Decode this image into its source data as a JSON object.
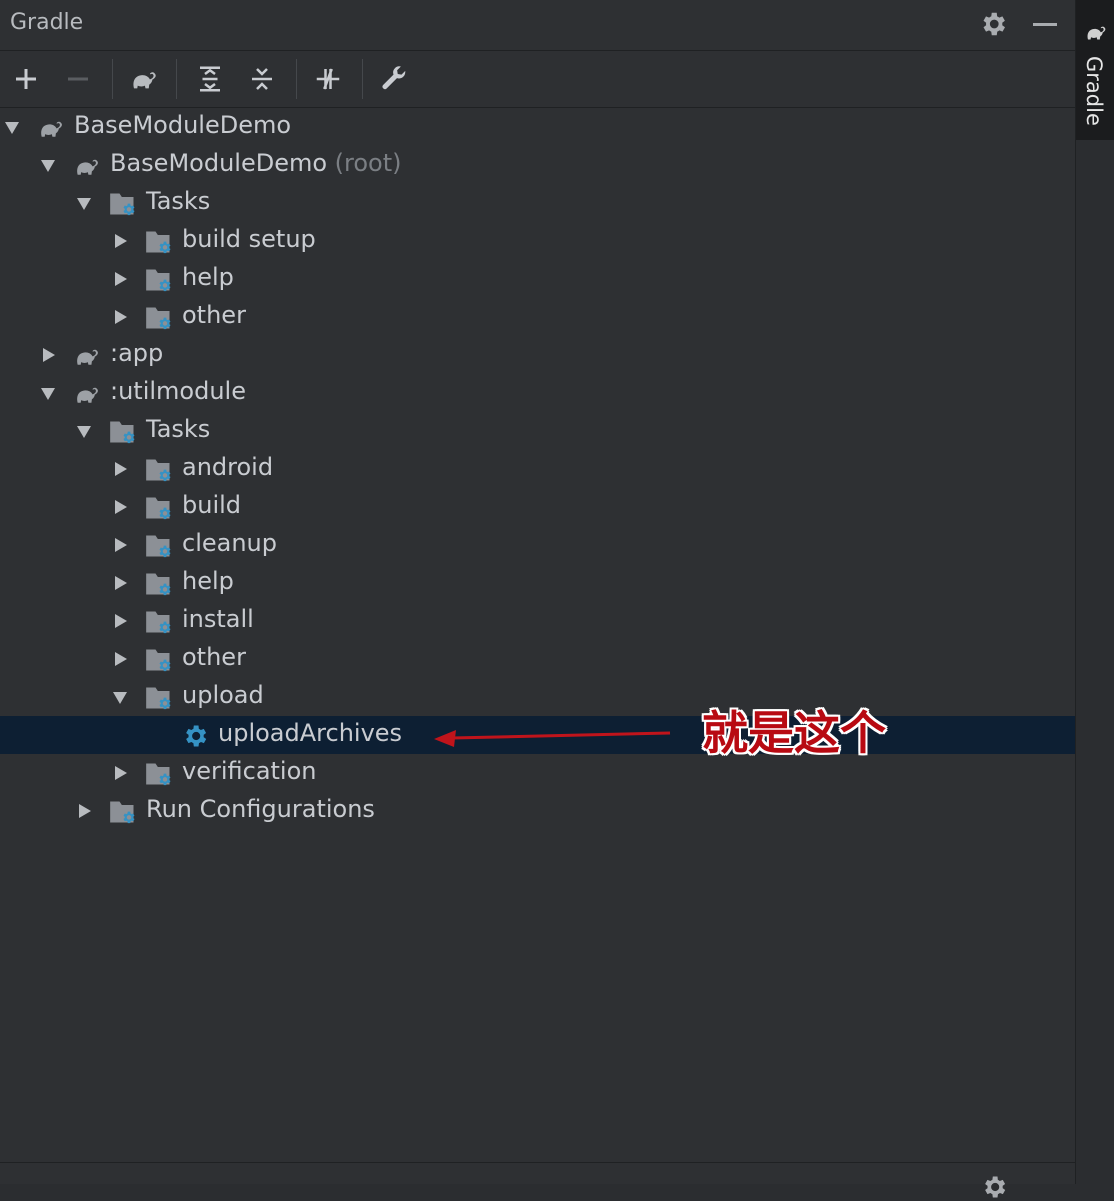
{
  "panel": {
    "title": "Gradle",
    "settings_icon": "gear-icon",
    "minimize_icon": "minimize-icon"
  },
  "toolbar": [
    {
      "icon": "add-icon"
    },
    {
      "icon": "remove-icon"
    },
    {
      "icon": "elephant-icon"
    },
    {
      "icon": "expand-all-icon"
    },
    {
      "icon": "collapse-all-icon"
    },
    {
      "icon": "toggle-offline-icon"
    },
    {
      "icon": "wrench-icon"
    }
  ],
  "tree": [
    {
      "label": "BaseModuleDemo",
      "suffix": "",
      "level": 0,
      "icon": "elephant",
      "expanded": true,
      "selected": false
    },
    {
      "label": "BaseModuleDemo",
      "suffix": "(root)",
      "level": 1,
      "icon": "elephant",
      "expanded": true,
      "selected": false
    },
    {
      "label": "Tasks",
      "suffix": "",
      "level": 2,
      "icon": "folder",
      "expanded": true,
      "selected": false
    },
    {
      "label": "build setup",
      "suffix": "",
      "level": 3,
      "icon": "folder",
      "expanded": false,
      "selected": false
    },
    {
      "label": "help",
      "suffix": "",
      "level": 3,
      "icon": "folder",
      "expanded": false,
      "selected": false
    },
    {
      "label": "other",
      "suffix": "",
      "level": 3,
      "icon": "folder",
      "expanded": false,
      "selected": false
    },
    {
      "label": ":app",
      "suffix": "",
      "level": 1,
      "icon": "elephant",
      "expanded": false,
      "selected": false
    },
    {
      "label": ":utilmodule",
      "suffix": "",
      "level": 1,
      "icon": "elephant",
      "expanded": true,
      "selected": false
    },
    {
      "label": "Tasks",
      "suffix": "",
      "level": 2,
      "icon": "folder",
      "expanded": true,
      "selected": false
    },
    {
      "label": "android",
      "suffix": "",
      "level": 3,
      "icon": "folder",
      "expanded": false,
      "selected": false
    },
    {
      "label": "build",
      "suffix": "",
      "level": 3,
      "icon": "folder",
      "expanded": false,
      "selected": false
    },
    {
      "label": "cleanup",
      "suffix": "",
      "level": 3,
      "icon": "folder",
      "expanded": false,
      "selected": false
    },
    {
      "label": "help",
      "suffix": "",
      "level": 3,
      "icon": "folder",
      "expanded": false,
      "selected": false
    },
    {
      "label": "install",
      "suffix": "",
      "level": 3,
      "icon": "folder",
      "expanded": false,
      "selected": false
    },
    {
      "label": "other",
      "suffix": "",
      "level": 3,
      "icon": "folder",
      "expanded": false,
      "selected": false
    },
    {
      "label": "upload",
      "suffix": "",
      "level": 3,
      "icon": "folder",
      "expanded": true,
      "selected": false
    },
    {
      "label": "uploadArchives",
      "suffix": "",
      "level": 4,
      "icon": "gear",
      "expanded": null,
      "selected": true
    },
    {
      "label": "verification",
      "suffix": "",
      "level": 3,
      "icon": "folder",
      "expanded": false,
      "selected": false
    },
    {
      "label": "Run Configurations",
      "suffix": "",
      "level": 2,
      "icon": "folder",
      "expanded": false,
      "selected": false
    }
  ],
  "side_tab": {
    "label": "Gradle",
    "icon": "elephant-icon"
  },
  "annotation": {
    "text": "就是这个",
    "color": "#b80a12"
  },
  "colors": {
    "background": "#2e3033",
    "selection": "#0d1f33",
    "text": "#c9ccd1",
    "accent_gear": "#3592c4"
  }
}
